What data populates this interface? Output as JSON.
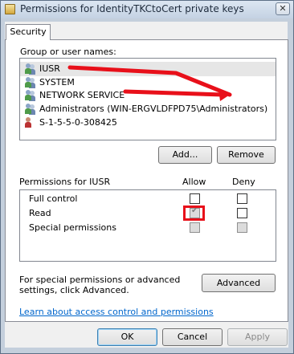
{
  "window": {
    "title": "Permissions for IdentityTKCtoCert private keys",
    "close_label": "✕"
  },
  "tabs": [
    {
      "label": "Security"
    }
  ],
  "group_section": {
    "label": "Group or user names:",
    "items": [
      {
        "label": "IUSR",
        "icon": "users-icon"
      },
      {
        "label": "SYSTEM",
        "icon": "users-icon"
      },
      {
        "label": "NETWORK SERVICE",
        "icon": "users-icon"
      },
      {
        "label": "Administrators (WIN-ERGVLDFPD75\\Administrators)",
        "icon": "users-icon"
      },
      {
        "label": "S-1-5-5-0-308425",
        "icon": "unknown-sid-icon"
      }
    ],
    "add_label": "Add...",
    "remove_label": "Remove"
  },
  "permissions": {
    "header": "Permissions for IUSR",
    "allow_header": "Allow",
    "deny_header": "Deny",
    "rows": [
      {
        "label": "Full control",
        "allow": false,
        "deny": false
      },
      {
        "label": "Read",
        "allow": true,
        "deny": false
      },
      {
        "label": "Special permissions",
        "allow": false,
        "deny": false
      }
    ]
  },
  "advanced": {
    "note": "For special permissions or advanced settings, click Advanced.",
    "button_label": "Advanced"
  },
  "help_link": "Learn about access control and permissions",
  "footer": {
    "ok_label": "OK",
    "cancel_label": "Cancel",
    "apply_label": "Apply"
  },
  "colors": {
    "annotation": "#e8101a",
    "link": "#0066cc",
    "selection": "#e6e6e6"
  }
}
